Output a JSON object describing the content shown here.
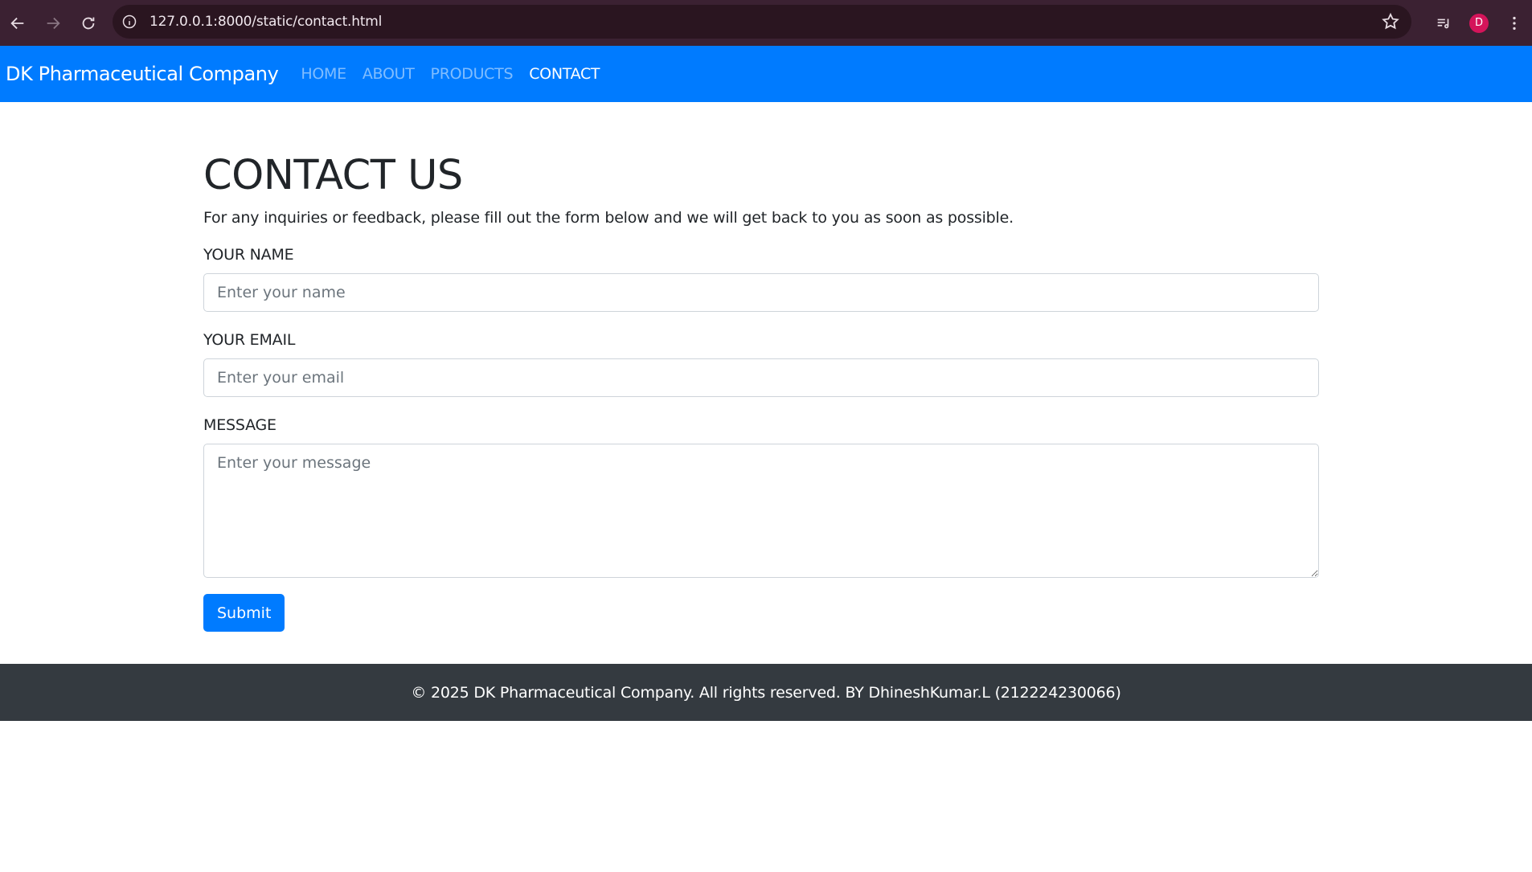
{
  "browser": {
    "url": "127.0.0.1:8000/static/contact.html",
    "profile_initial": "D",
    "icons": [
      "back-icon",
      "forward-icon",
      "reload-icon",
      "site-info-icon",
      "bookmark-star-icon",
      "media-control-icon",
      "profile-avatar",
      "kebab-menu-icon"
    ]
  },
  "navbar": {
    "brand": "DK Pharmaceutical Company",
    "links": [
      {
        "label": "HOME",
        "active": false
      },
      {
        "label": "ABOUT",
        "active": false
      },
      {
        "label": "PRODUCTS",
        "active": false
      },
      {
        "label": "CONTACT",
        "active": true
      }
    ],
    "color": "#007bff"
  },
  "contact": {
    "title": "CONTACT US",
    "intro": "For any inquiries or feedback, please fill out the form below and we will get back to you as soon as possible.",
    "name_label": "YOUR NAME",
    "name_placeholder": "Enter your name",
    "email_label": "YOUR EMAIL",
    "email_placeholder": "Enter your email",
    "message_label": "MESSAGE",
    "message_placeholder": "Enter your message",
    "submit_label": "Submit"
  },
  "footer": {
    "text": "© 2025 DK Pharmaceutical Company. All rights reserved. BY DhineshKumar.L (212224230066)",
    "color": "#343a40"
  }
}
